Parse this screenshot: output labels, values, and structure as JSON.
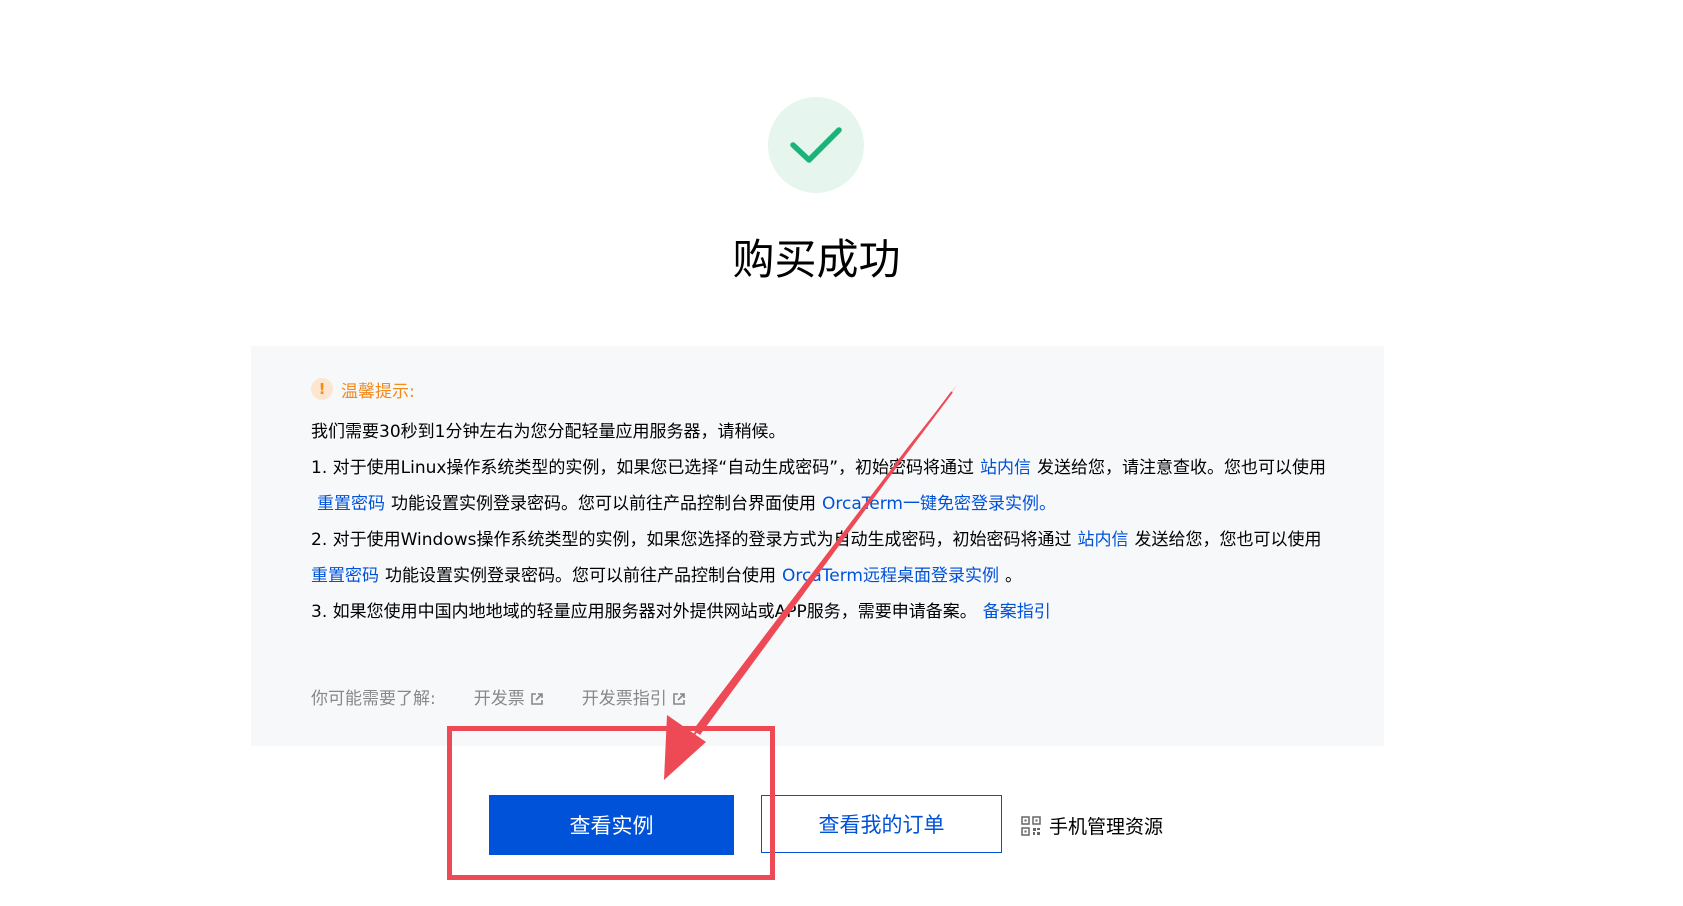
{
  "page": {
    "title": "购买成功",
    "status_icon": "check-icon",
    "accent_color": "#0052d9",
    "success_color": "#1ab37a"
  },
  "tips": {
    "icon": "exclamation-icon",
    "title": "温馨提示:",
    "intro": "我们需要30秒到1分钟左右为您分配轻量应用服务器，请稍候。",
    "item1": {
      "part1": "1. 对于使用Linux操作系统类型的实例，如果您已选择“自动生成密码”，初始密码将通过",
      "link1": "站内信",
      "part2": "发送给您，请注意查收。您也可以使用",
      "link2": "重置密码",
      "part3": "功能设置实例登录密码。您可以前往产品控制台界面使用",
      "link3": "OrcaTerm一键免密登录实例",
      "part4": "。"
    },
    "item2": {
      "part1": "2. 对于使用Windows操作系统类型的实例，如果您选择的登录方式为自动生成密码，初始密码将通过",
      "link1": "站内信",
      "part2": "发送给您，您也可以使用",
      "link2": "重置密码",
      "part3": "功能设置实例登录密码。您可以前往产品控制台使用",
      "link3": "OrcaTerm远程桌面登录实例",
      "part4": "。"
    },
    "item3": {
      "part1": "3. 如果您使用中国内地地域的轻量应用服务器对外提供网站或APP服务，需要申请备案。",
      "link1": "备案指引"
    }
  },
  "learn_more": {
    "label": "你可能需要了解:",
    "links": [
      "开发票",
      "开发票指引"
    ],
    "link_icon": "external-link-icon"
  },
  "actions": {
    "view_instance": "查看实例",
    "view_orders": "查看我的订单",
    "mobile_manage": "手机管理资源",
    "mobile_icon": "qr-code-icon"
  },
  "annotation": {
    "color": "#ee4a56"
  }
}
